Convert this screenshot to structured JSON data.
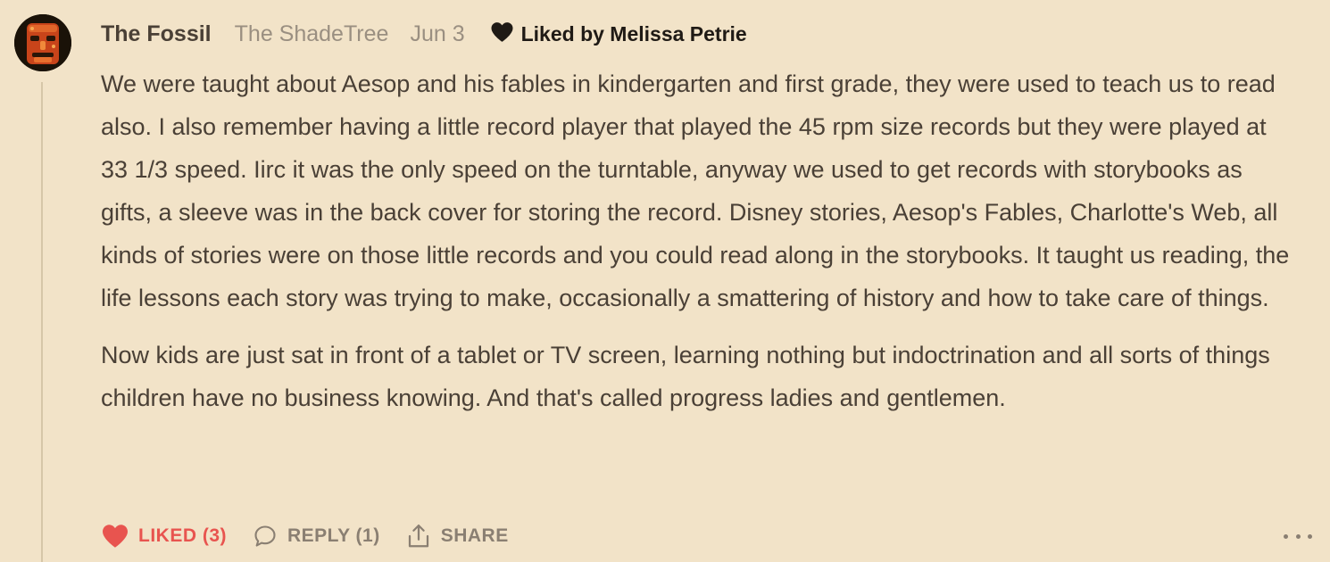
{
  "comment": {
    "author": "The Fossil",
    "publication": "The ShadeTree",
    "date": "Jun 3",
    "liked_by": "Liked by Melissa Petrie",
    "paragraphs": [
      "We were taught about Aesop and his fables in kindergarten and first grade, they were used to teach us to read also. I also remember having a little record player that played the 45 rpm size records but they were played at 33 1/3 speed. Iirc it was the only speed on the turntable, anyway we used to get records with storybooks as gifts, a sleeve was in the back cover for storing the record. Disney stories, Aesop's Fables, Charlotte's Web, all kinds of stories were on those little records and you could read along in the storybooks. It taught us reading, the life lessons each story was trying to make, occasionally a smattering of history and how to take care of things.",
      "Now kids are just sat in front of a tablet or TV screen, learning nothing but indoctrination and all sorts of things children have no business knowing. And that's called progress ladies and gentlemen."
    ]
  },
  "actions": {
    "like_label": "LIKED (3)",
    "reply_label": "REPLY (1)",
    "share_label": "SHARE"
  },
  "icons": {
    "liked_by": "heart-icon",
    "like": "heart-filled-icon",
    "reply": "speech-bubble-icon",
    "share": "share-upload-icon",
    "more": "ellipsis-icon"
  },
  "colors": {
    "background": "#f2e3c8",
    "text": "#4a4036",
    "muted": "#9a8f81",
    "liked_accent": "#e8544f",
    "action": "#8a7f72"
  }
}
